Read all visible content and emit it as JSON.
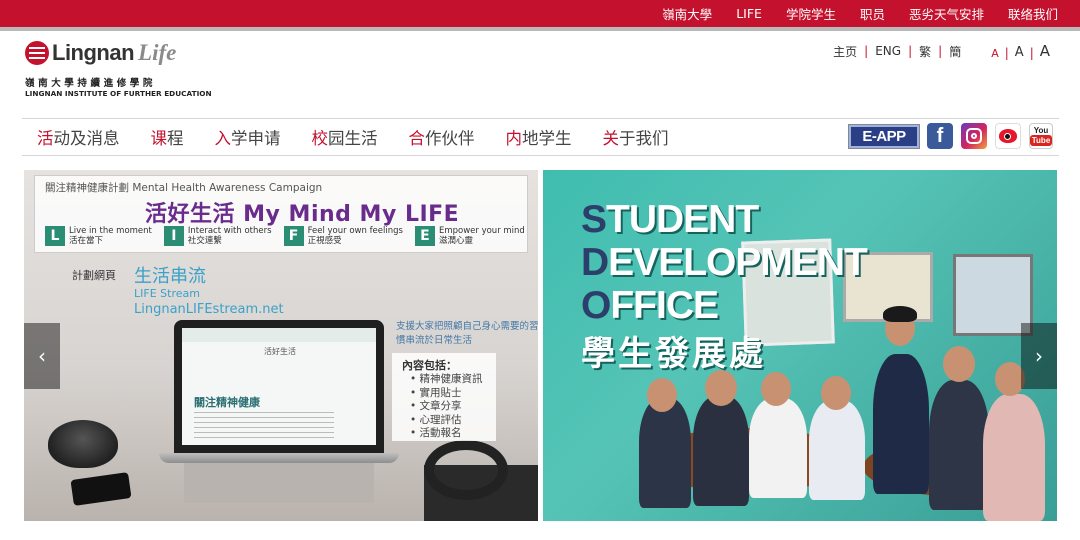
{
  "topbar": {
    "links": [
      "嶺南大學",
      "LIFE",
      "学院学生",
      "职员",
      "恶劣天气安排",
      "联络我们"
    ]
  },
  "logo": {
    "name": "Lingnan",
    "suffix": "Life",
    "chinese": "嶺南大學持續進修學院",
    "english": "LINGNAN INSTITUTE OF FURTHER EDUCATION"
  },
  "langbar": {
    "items": [
      "主页",
      "ENG",
      "繁",
      "簡"
    ],
    "font_sizes": [
      "A",
      "A",
      "A"
    ]
  },
  "nav": {
    "items": [
      {
        "first": "活",
        "rest": "动及消息"
      },
      {
        "first": "课",
        "rest": "程"
      },
      {
        "first": "入",
        "rest": "学申请"
      },
      {
        "first": "校",
        "rest": "园生活"
      },
      {
        "first": "合",
        "rest": "作伙伴"
      },
      {
        "first": "内",
        "rest": "地学生"
      },
      {
        "first": "关",
        "rest": "于我们"
      }
    ]
  },
  "social": {
    "eapp_label": "E-APP",
    "facebook_label": "f",
    "youtube_you": "You",
    "youtube_tube": "Tube",
    "icons": [
      "facebook-icon",
      "instagram-icon",
      "weibo-icon",
      "youtube-icon"
    ]
  },
  "slide_left": {
    "subtitle": "關注精神健康計劃 Mental Health Awareness Campaign",
    "title": "活好生活 My Mind My LIFE",
    "life": [
      {
        "letter": "L",
        "en": "Live in the moment",
        "cn": "活在當下"
      },
      {
        "letter": "I",
        "en": "Interact with others",
        "cn": "社交連繫"
      },
      {
        "letter": "F",
        "en": "Feel your own feelings",
        "cn": "正視感受"
      },
      {
        "letter": "E",
        "en": "Empower your mind",
        "cn": "滋潤心靈"
      }
    ],
    "stream_label": "計劃網頁",
    "stream_title": "生活串流",
    "stream_en": "LIFE Stream",
    "stream_url": "LingnanLIFEstream.net",
    "support": "支援大家把照顧自己身心需要的習慣串流於日常生活",
    "content_title": "內容包括：",
    "content_items": [
      "• 精神健康資訊",
      "• 實用貼士",
      "• 文章分享",
      "• 心理評估",
      "• 活動報名"
    ],
    "laptop_heading": "活好生活",
    "laptop_title": "關注精神健康"
  },
  "slide_right": {
    "line1_hl": "S",
    "line1": "TUDENT",
    "line2_hl": "D",
    "line2": "EVELOPMENT",
    "line3_hl": "O",
    "line3": "FFICE",
    "chinese": "學生發展處"
  },
  "slider": {
    "prev_label": "‹",
    "next_label": "›"
  },
  "colors": {
    "brand_red": "#c4122e",
    "accent_purple": "#6a2c8c",
    "teal": "#3fbdb0"
  }
}
